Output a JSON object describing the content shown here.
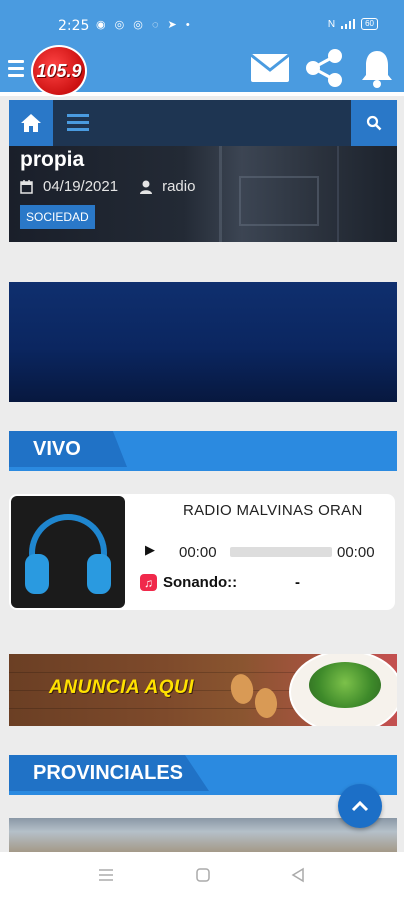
{
  "status_bar": {
    "time": "2:25",
    "notifications": "◉ ◎ ◎ ◌ ➤ •",
    "system": "N",
    "battery": "60"
  },
  "header": {
    "logo_text": "105.9",
    "icons": [
      "menu-icon",
      "mail-icon",
      "share-icon",
      "bell-icon"
    ],
    "brand_color": "#4a9be0"
  },
  "nav": {
    "icons": [
      "home-icon",
      "list-icon",
      "search-icon"
    ],
    "bar_color": "#1e3552",
    "accent_color": "#2a78c8"
  },
  "featured": {
    "title": "propia",
    "date": "04/19/2021",
    "author": "radio",
    "category": "SOCIEDAD"
  },
  "sections": {
    "live": "VIVO",
    "provincial": "PROVINCIALES"
  },
  "player": {
    "station": "RADIO MALVINAS ORAN",
    "current_time": "00:00",
    "duration": "00:00",
    "progress": 0,
    "now_playing_label": "Sonando::",
    "now_playing_value": "-"
  },
  "ad": {
    "text": "ANUNCIA AQUI"
  }
}
